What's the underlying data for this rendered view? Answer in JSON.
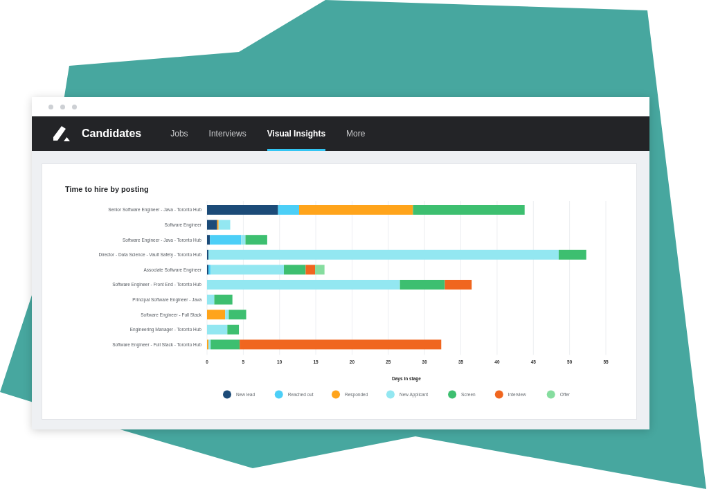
{
  "app_bar": {
    "title": "Candidates",
    "nav": [
      {
        "label": "Jobs",
        "selected": false
      },
      {
        "label": "Interviews",
        "selected": false
      },
      {
        "label": "Visual Insights",
        "selected": true
      },
      {
        "label": "More",
        "selected": false
      }
    ]
  },
  "insights_card": {
    "chart_data": {
      "type": "bar",
      "orientation": "horizontal",
      "stacked": true,
      "title": "Time to hire by posting",
      "xlabel": "Days in stage",
      "categories": [
        "Senior Software Engineer - Java - Toronto Hub",
        "Software Engineer",
        "Software Engineer - Java - Toronto Hub",
        "Director - Data Science - Vault Safety - Toronto Hub",
        "Associate Software Engineer",
        "Software Engineer - Front End - Toronto Hub",
        "Principal Software Engineer - Java",
        "Software Engineer - Full Stack",
        "Engineering Manager - Toronto Hub",
        "Software Engineer - Full Stack - Toronto Hub"
      ],
      "series": [
        {
          "name": "New lead",
          "color": "#1c4b78",
          "values": [
            9.8,
            1.4,
            0.4,
            0.2,
            0.2,
            0,
            0,
            0,
            0,
            0
          ]
        },
        {
          "name": "Reached out",
          "color": "#4ccff7",
          "values": [
            2.9,
            0,
            4.3,
            0,
            0.3,
            0,
            0,
            0,
            0,
            0
          ]
        },
        {
          "name": "Responded",
          "color": "#ffa41b",
          "values": [
            15.7,
            0.2,
            0,
            0,
            0,
            0,
            0,
            2.5,
            0,
            0.2
          ]
        },
        {
          "name": "New Applicant",
          "color": "#93e7f1",
          "values": [
            0,
            1.6,
            0.6,
            48.3,
            10.1,
            26.6,
            1.0,
            0.5,
            2.8,
            0.3
          ]
        },
        {
          "name": "Screen",
          "color": "#3dbf70",
          "values": [
            15.4,
            0,
            3.0,
            3.8,
            3.0,
            6.2,
            2.5,
            2.4,
            1.6,
            4.0
          ]
        },
        {
          "name": "Interview",
          "color": "#f0661f",
          "values": [
            0,
            0,
            0,
            0,
            1.3,
            3.7,
            0,
            0,
            0,
            27.8
          ]
        },
        {
          "name": "Offer",
          "color": "#86dd9f",
          "values": [
            0,
            0,
            0,
            0,
            1.3,
            0,
            0,
            0,
            0,
            0
          ]
        }
      ],
      "xlim": [
        0,
        55
      ],
      "xticks": [
        0,
        5,
        10,
        15,
        20,
        25,
        30,
        35,
        40,
        45,
        50,
        55
      ],
      "grid": true,
      "legend": true
    }
  }
}
